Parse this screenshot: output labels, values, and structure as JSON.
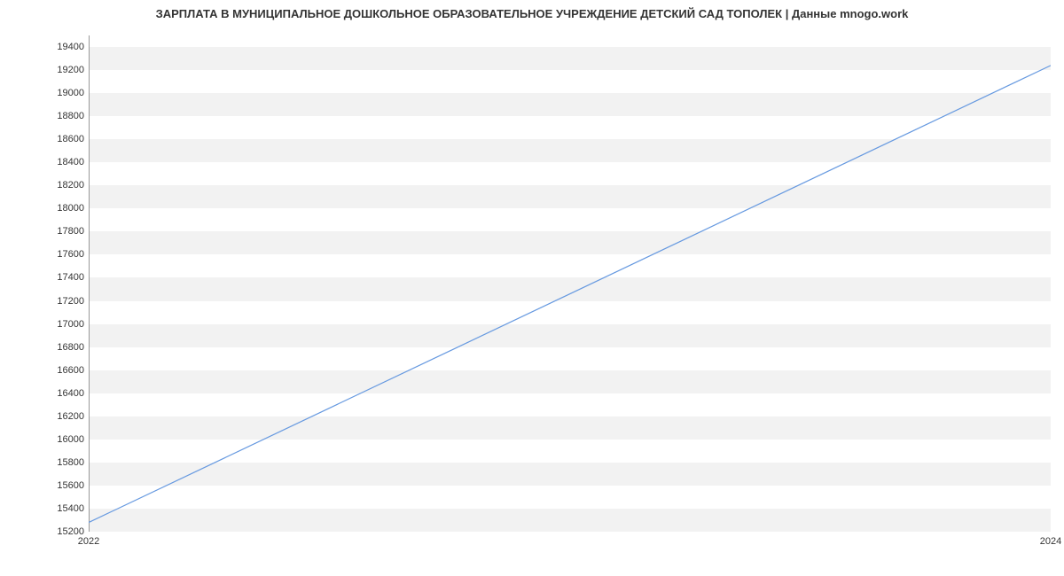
{
  "chart_data": {
    "type": "line",
    "title": "ЗАРПЛАТА В МУНИЦИПАЛЬНОЕ ДОШКОЛЬНОЕ ОБРАЗОВАТЕЛЬНОЕ УЧРЕЖДЕНИЕ ДЕТСКИЙ САД ТОПОЛЕК | Данные mnogo.work",
    "xlabel": "",
    "ylabel": "",
    "x": [
      2022,
      2024
    ],
    "values": [
      15280,
      19240
    ],
    "x_ticks": [
      2022,
      2024
    ],
    "y_ticks": [
      15200,
      15400,
      15600,
      15800,
      16000,
      16200,
      16400,
      16600,
      16800,
      17000,
      17200,
      17400,
      17600,
      17800,
      18000,
      18200,
      18400,
      18600,
      18800,
      19000,
      19200,
      19400
    ],
    "xlim": [
      2022,
      2024
    ],
    "ylim": [
      15200,
      19500
    ],
    "line_color": "#6699e0",
    "grid": true
  }
}
